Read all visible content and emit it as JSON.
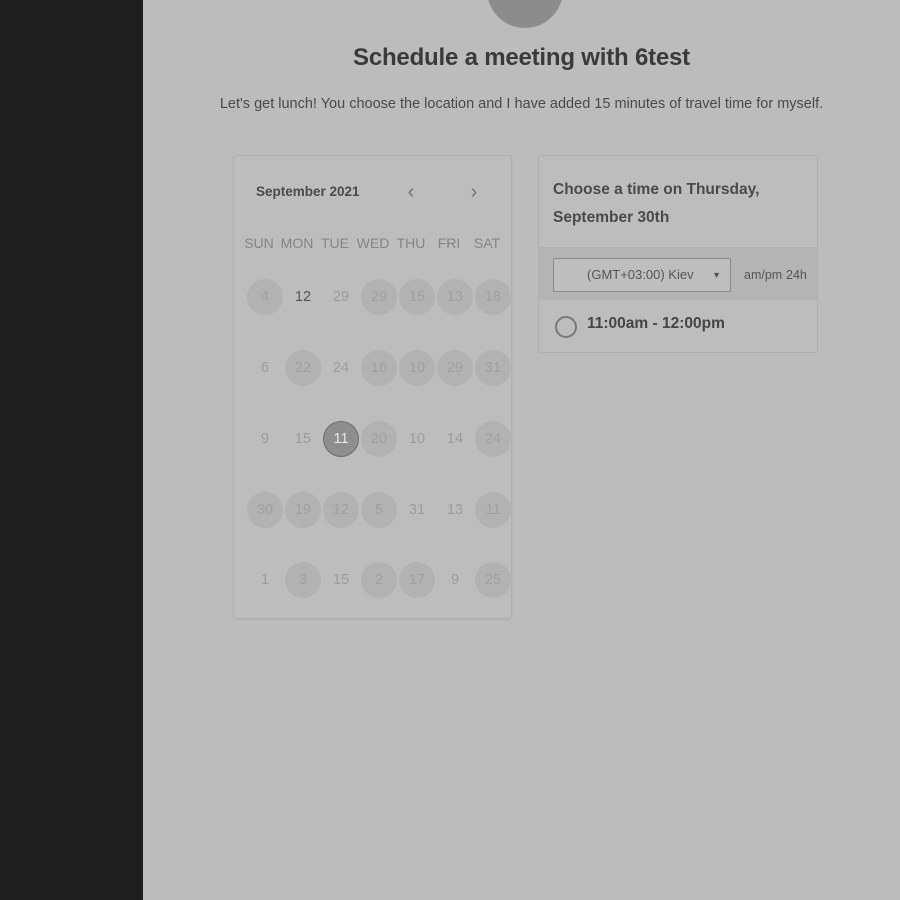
{
  "page": {
    "title": "Schedule a meeting with 6test",
    "subtitle": "Let's get lunch! You choose the location and I have added 15 minutes of travel time for myself."
  },
  "calendar": {
    "month_label": "September 2021",
    "prev_icon": "‹",
    "next_icon": "›",
    "weekdays": [
      "SUN",
      "MON",
      "TUE",
      "WED",
      "THU",
      "FRI",
      "SAT"
    ],
    "weeks": [
      [
        {
          "label": "4",
          "state": "available"
        },
        {
          "label": "12",
          "state": "bold"
        },
        {
          "label": "29",
          "state": "plain"
        },
        {
          "label": "29",
          "state": "available"
        },
        {
          "label": "15",
          "state": "available"
        },
        {
          "label": "13",
          "state": "available"
        },
        {
          "label": "18",
          "state": "available"
        }
      ],
      [
        {
          "label": "6",
          "state": "plain"
        },
        {
          "label": "22",
          "state": "available"
        },
        {
          "label": "24",
          "state": "plain"
        },
        {
          "label": "16",
          "state": "available"
        },
        {
          "label": "10",
          "state": "available"
        },
        {
          "label": "29",
          "state": "available"
        },
        {
          "label": "31",
          "state": "available"
        }
      ],
      [
        {
          "label": "9",
          "state": "plain"
        },
        {
          "label": "15",
          "state": "plain"
        },
        {
          "label": "11",
          "state": "selected"
        },
        {
          "label": "20",
          "state": "available"
        },
        {
          "label": "10",
          "state": "plain"
        },
        {
          "label": "14",
          "state": "plain"
        },
        {
          "label": "24",
          "state": "available"
        }
      ],
      [
        {
          "label": "30",
          "state": "available"
        },
        {
          "label": "19",
          "state": "available"
        },
        {
          "label": "12",
          "state": "available"
        },
        {
          "label": "5",
          "state": "available"
        },
        {
          "label": "31",
          "state": "plain"
        },
        {
          "label": "13",
          "state": "plain"
        },
        {
          "label": "11",
          "state": "available"
        }
      ],
      [
        {
          "label": "1",
          "state": "plain"
        },
        {
          "label": "3",
          "state": "available"
        },
        {
          "label": "15",
          "state": "plain"
        },
        {
          "label": "2",
          "state": "available"
        },
        {
          "label": "17",
          "state": "available"
        },
        {
          "label": "9",
          "state": "plain"
        },
        {
          "label": "25",
          "state": "available"
        }
      ]
    ]
  },
  "times": {
    "heading": "Choose a time on Thursday, September 30th",
    "timezone": "(GMT+03:00) Kiev",
    "caret": "▼",
    "format_ampm": "am/pm",
    "format_24h": "24h",
    "slots": [
      "11:00am - 12:00pm"
    ]
  }
}
